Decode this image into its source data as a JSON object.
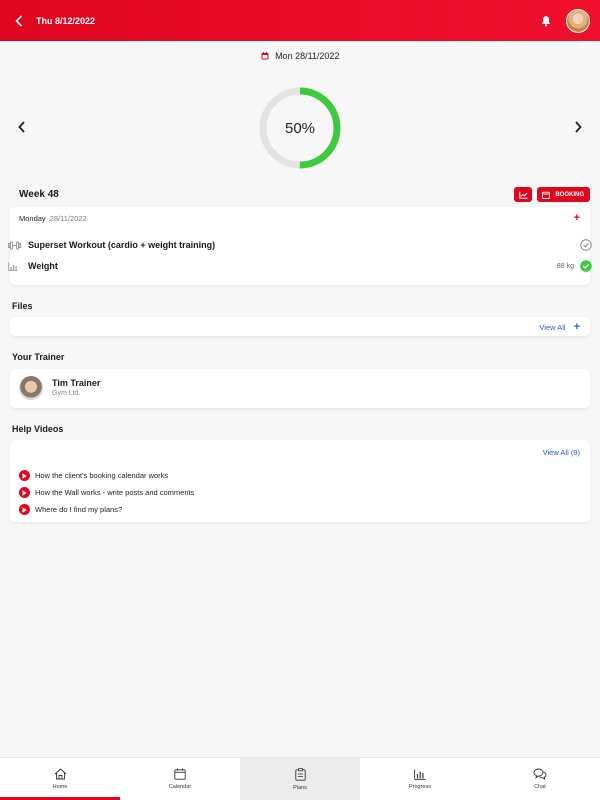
{
  "header": {
    "title": "Thu 8/12/2022"
  },
  "date_selector": {
    "date": "Mon 28/11/2022"
  },
  "progress": {
    "label": "50%",
    "value": 0.5
  },
  "week": {
    "title": "Week 48",
    "booking_label": "BOOKING",
    "day": {
      "name": "Monday",
      "date": "28/11/2022"
    },
    "items": [
      {
        "label": "Superset Workout (cardio + weight training)",
        "value": ""
      },
      {
        "label": "Weight",
        "value": "88 kg"
      }
    ]
  },
  "files": {
    "title": "Files",
    "view_all": "View All"
  },
  "trainer": {
    "title": "Your Trainer",
    "name": "Tim Trainer",
    "org": "Gym Ltd."
  },
  "help": {
    "title": "Help Videos",
    "view_all": "View All (9)",
    "items": [
      "How the client's booking calendar works",
      "How the Wall works - write posts and comments",
      "Where do I find my plans?"
    ]
  },
  "tabs": [
    {
      "label": "Home"
    },
    {
      "label": "Calendar"
    },
    {
      "label": "Plans"
    },
    {
      "label": "Progress"
    },
    {
      "label": "Chat"
    }
  ],
  "colors": {
    "brand": "#e0061f",
    "progress": "#3dcb3d",
    "link": "#2d5bd8"
  }
}
